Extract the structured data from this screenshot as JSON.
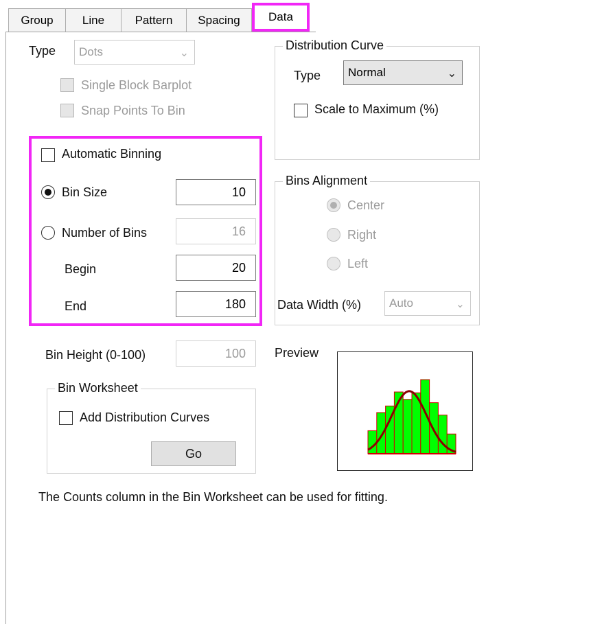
{
  "tabs": [
    {
      "label": "Group"
    },
    {
      "label": "Line"
    },
    {
      "label": "Pattern"
    },
    {
      "label": "Spacing"
    },
    {
      "label": "Data",
      "active": true
    }
  ],
  "type": {
    "label": "Type",
    "value": "Dots"
  },
  "single_block_barplot": {
    "label": "Single Block Barplot",
    "checked": false,
    "enabled": false
  },
  "snap_points_to_bin": {
    "label": "Snap Points To Bin",
    "checked": false,
    "enabled": false
  },
  "binning": {
    "automatic_binning": {
      "label": "Automatic Binning",
      "checked": false
    },
    "bin_size": {
      "label": "Bin Size",
      "selected": true,
      "value": "10"
    },
    "number_of_bins": {
      "label": "Number of Bins",
      "selected": false,
      "value": "16"
    },
    "begin": {
      "label": "Begin",
      "value": "20"
    },
    "end": {
      "label": "End",
      "value": "180"
    }
  },
  "distribution_curve": {
    "title": "Distribution Curve",
    "type_label": "Type",
    "type_value": "Normal",
    "scale_to_max": {
      "label": "Scale to Maximum (%)",
      "checked": false
    }
  },
  "bins_alignment": {
    "title": "Bins Alignment",
    "options": [
      {
        "label": "Center",
        "selected": true
      },
      {
        "label": "Right",
        "selected": false
      },
      {
        "label": "Left",
        "selected": false
      }
    ],
    "data_width_label": "Data Width (%)",
    "data_width_value": "Auto"
  },
  "bin_height": {
    "label": "Bin Height (0-100)",
    "value": "100"
  },
  "preview": {
    "label": "Preview",
    "bar_heights": [
      0.28,
      0.5,
      0.58,
      0.75,
      0.66,
      0.74,
      0.9,
      0.62,
      0.47,
      0.24
    ],
    "bar_color": "#00ff00",
    "bar_border_color": "#d10000",
    "curve_color": "#8b0000"
  },
  "bin_worksheet": {
    "title": "Bin Worksheet",
    "add_distribution_curves": {
      "label": "Add Distribution Curves",
      "checked": false
    },
    "go_label": "Go"
  },
  "footer_note": "The Counts column in the Bin Worksheet can be used for fitting.",
  "highlight_color": "#f126f6"
}
